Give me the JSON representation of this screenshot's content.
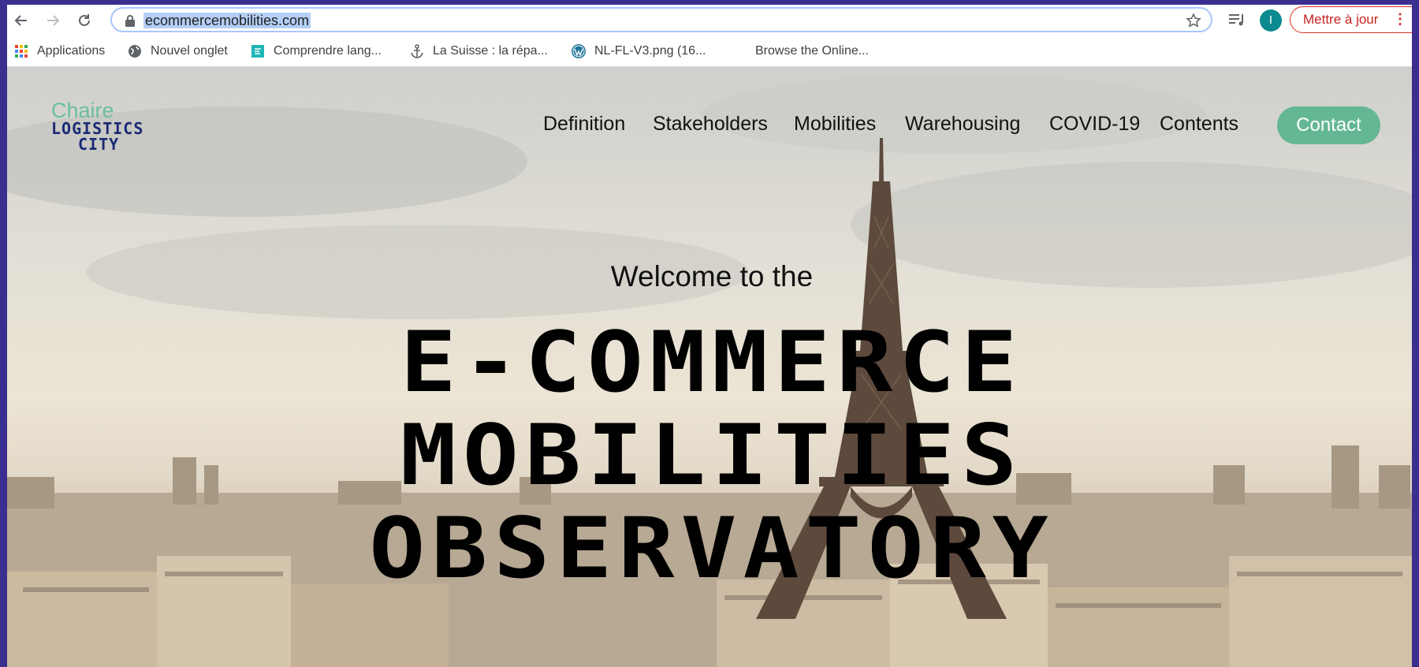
{
  "browser": {
    "url": "ecommercemobilities.com",
    "update_label": "Mettre à jour",
    "profile_initial": "I",
    "icons": [
      "back-arrow-icon",
      "forward-arrow-icon",
      "reload-icon",
      "lock-icon",
      "star-icon",
      "media-queue-icon",
      "kebab-menu-icon"
    ]
  },
  "bookmarks": [
    {
      "label": "Applications",
      "icon": "apps-grid-icon"
    },
    {
      "label": "Nouvel onglet",
      "icon": "globe-icon"
    },
    {
      "label": "Comprendre lang...",
      "icon": "site-favicon-icon"
    },
    {
      "label": "La Suisse : la répa...",
      "icon": "anchor-icon"
    },
    {
      "label": "NL-FL-V3.png (16...",
      "icon": "wordpress-icon"
    },
    {
      "label": "Browse the Online...",
      "icon": ""
    }
  ],
  "site": {
    "logo": {
      "line1": "Chaire",
      "line2": "LOGISTICS",
      "line3": "CITY"
    },
    "nav": [
      "Definition",
      "Stakeholders",
      "Mobilities",
      "Warehousing",
      "COVID-19",
      "Contents"
    ],
    "contact_label": "Contact",
    "welcome": "Welcome to the",
    "hero_lines": [
      "E-COMMERCE",
      "MOBILITIES",
      "OBSERVATORY"
    ],
    "colors": {
      "accent": "#63b793",
      "logo_green": "#6abf9c",
      "logo_navy": "#1b2a74",
      "update_red": "#c5221f"
    }
  }
}
